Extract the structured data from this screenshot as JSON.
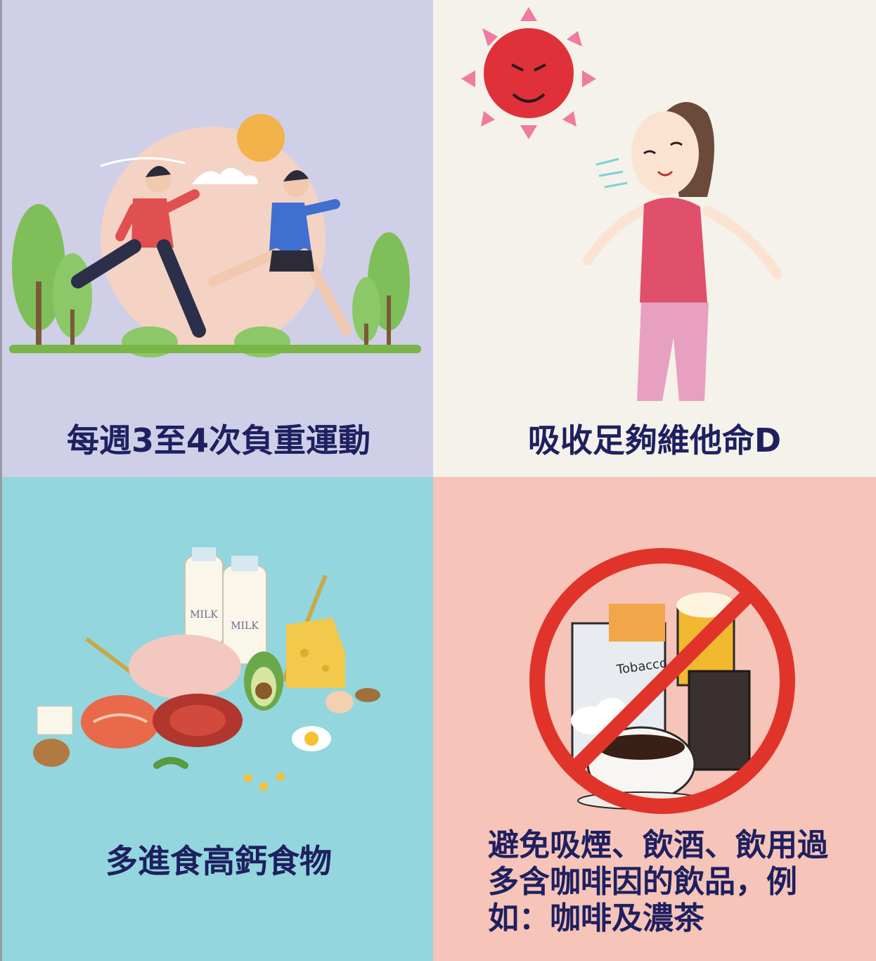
{
  "panels": [
    {
      "caption": "每週3至4次負重運動",
      "illustration": "people-running-illustration"
    },
    {
      "caption": "吸收足夠維他命D",
      "illustration": "sunbathing-woman-illustration"
    },
    {
      "caption": "多進食高鈣食物",
      "illustration": "calcium-food-illustration",
      "milk_labels": [
        "MILK",
        "MILK"
      ]
    },
    {
      "caption": "避免吸煙、飲酒、飲用過多含咖啡因的飲品，例如：咖啡及濃茶",
      "illustration": "no-smoking-drinking-coffee-illustration",
      "pack_label": "Tobacco"
    }
  ],
  "colors": {
    "caption_text": "#1e2060",
    "panel_1_bg": "#cfcfe8",
    "panel_2_bg": "#f4f2ea",
    "panel_3_bg": "#93d6dd",
    "panel_4_bg": "#f6c4b8",
    "prohibition_red": "#e0342b"
  }
}
